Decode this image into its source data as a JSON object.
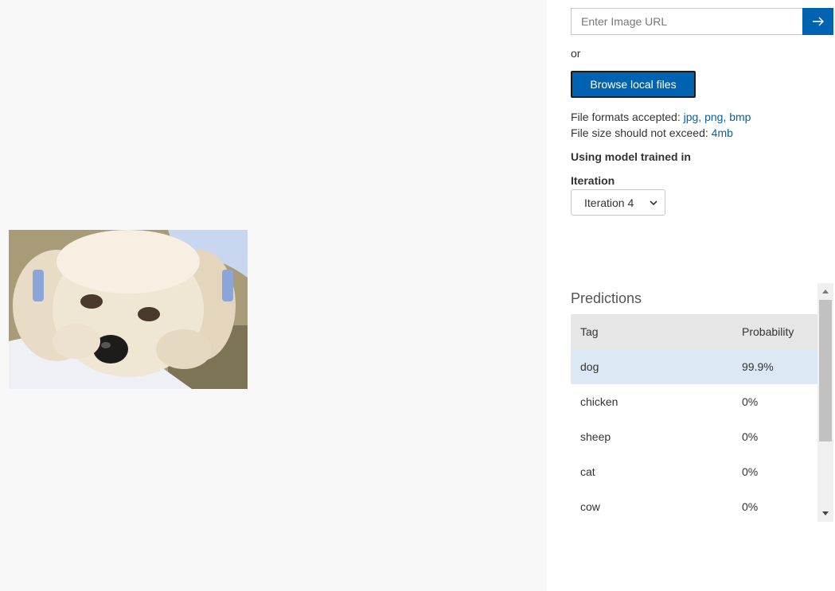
{
  "url_input": {
    "placeholder": "Enter Image URL",
    "submit_icon": "arrow-right-icon"
  },
  "or_label": "or",
  "browse_label": "Browse local files",
  "formats": {
    "accepted_label": "File formats accepted:",
    "accepted_values": "jpg, png, bmp",
    "size_label": "File size should not exceed:",
    "size_value": "4mb"
  },
  "model_label": "Using model trained in",
  "iteration": {
    "label": "Iteration",
    "selected": "Iteration 4"
  },
  "predictions": {
    "title": "Predictions",
    "columns": {
      "tag": "Tag",
      "probability": "Probability"
    },
    "rows": [
      {
        "tag": "dog",
        "probability": "99.9%"
      },
      {
        "tag": "chicken",
        "probability": "0%"
      },
      {
        "tag": "sheep",
        "probability": "0%"
      },
      {
        "tag": "cat",
        "probability": "0%"
      },
      {
        "tag": "cow",
        "probability": "0%"
      }
    ]
  },
  "colors": {
    "accent": "#0063b1",
    "selected_row": "#dce8f3",
    "header_bg": "#e6e6e6",
    "preview_bg": "#f8f8f8"
  }
}
